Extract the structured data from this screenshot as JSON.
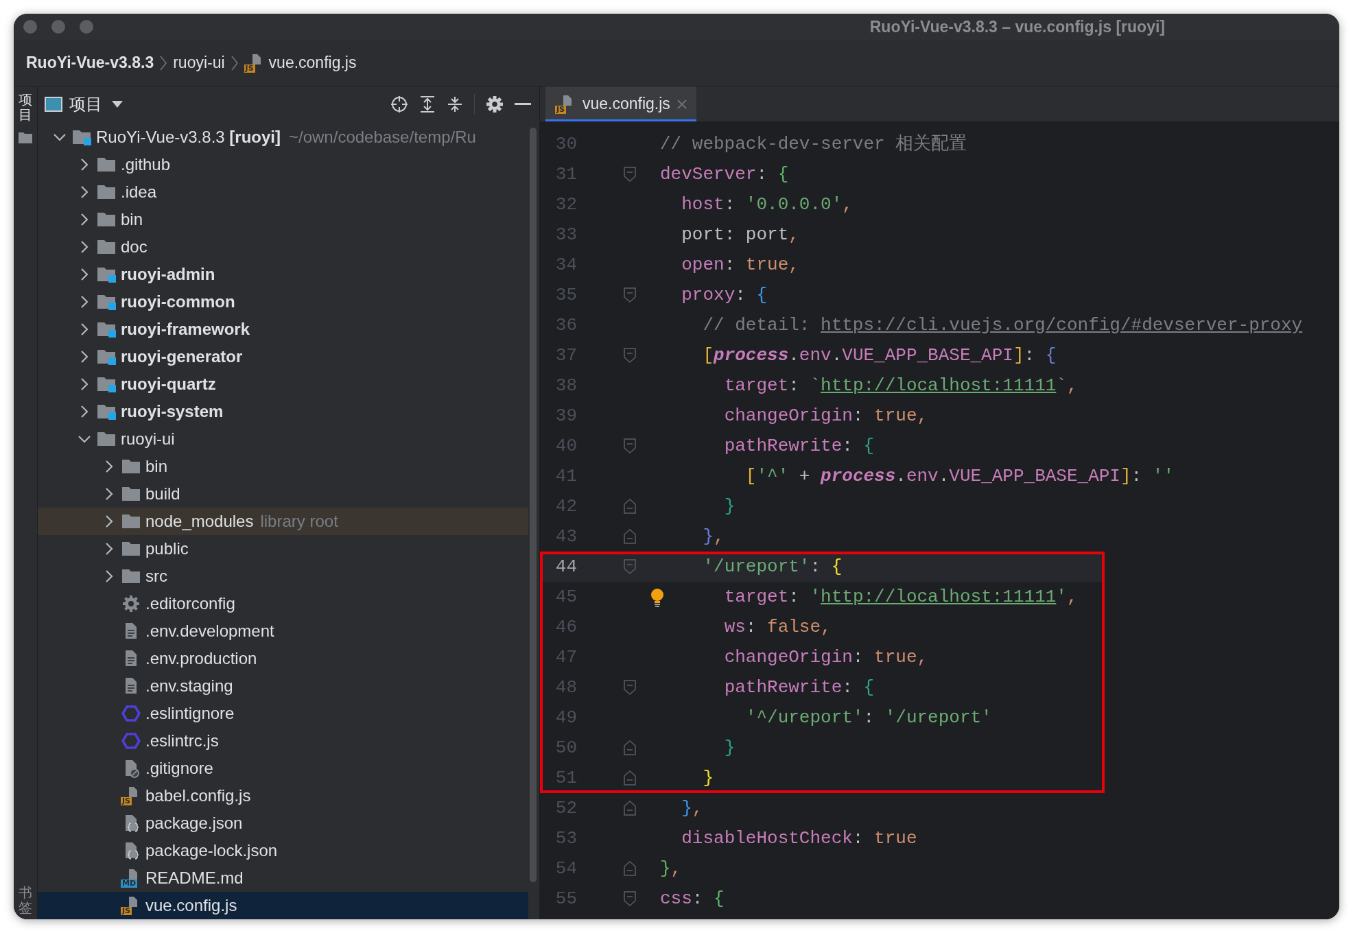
{
  "window": {
    "title": "RuoYi-Vue-v3.8.3 – vue.config.js [ruoyi]"
  },
  "breadcrumbs": [
    {
      "label": "RuoYi-Vue-v3.8.3",
      "bold": true
    },
    {
      "label": "ruoyi-ui",
      "bold": false
    },
    {
      "label": "vue.config.js",
      "bold": false,
      "badge": "JS"
    }
  ],
  "tool_strip": {
    "top_label": "项目",
    "bottom_label": "书签"
  },
  "project": {
    "title": "项目",
    "tree": [
      {
        "label": "RuoYi-Vue-v3.8.3 **[ruoyi]**",
        "path": "~/own/codebase/temp/Ru",
        "kind": "module",
        "bold": false,
        "expanded": true,
        "selected": false,
        "highlighted": false,
        "children": [
          {
            "label": ".github",
            "kind": "folder",
            "bold": false,
            "expanded": false,
            "selected": false,
            "highlighted": false
          },
          {
            "label": ".idea",
            "kind": "folder",
            "bold": false,
            "expanded": false,
            "selected": false,
            "highlighted": false
          },
          {
            "label": "bin",
            "kind": "folder",
            "bold": false,
            "expanded": false,
            "selected": false,
            "highlighted": false
          },
          {
            "label": "doc",
            "kind": "folder",
            "bold": false,
            "expanded": false,
            "selected": false,
            "highlighted": false
          },
          {
            "label": "ruoyi-admin",
            "kind": "module",
            "bold": true,
            "expanded": false,
            "selected": false,
            "highlighted": false
          },
          {
            "label": "ruoyi-common",
            "kind": "module",
            "bold": true,
            "expanded": false,
            "selected": false,
            "highlighted": false
          },
          {
            "label": "ruoyi-framework",
            "kind": "module",
            "bold": true,
            "expanded": false,
            "selected": false,
            "highlighted": false
          },
          {
            "label": "ruoyi-generator",
            "kind": "module",
            "bold": true,
            "expanded": false,
            "selected": false,
            "highlighted": false
          },
          {
            "label": "ruoyi-quartz",
            "kind": "module",
            "bold": true,
            "expanded": false,
            "selected": false,
            "highlighted": false
          },
          {
            "label": "ruoyi-system",
            "kind": "module",
            "bold": true,
            "expanded": false,
            "selected": false,
            "highlighted": false
          },
          {
            "label": "ruoyi-ui",
            "kind": "folder",
            "bold": false,
            "expanded": true,
            "selected": false,
            "highlighted": false,
            "children": [
              {
                "label": "bin",
                "kind": "folder",
                "bold": false,
                "expanded": false,
                "selected": false,
                "highlighted": false
              },
              {
                "label": "build",
                "kind": "folder",
                "bold": false,
                "expanded": false,
                "selected": false,
                "highlighted": false
              },
              {
                "label": "node_modules",
                "note": "library root",
                "kind": "folder",
                "bold": false,
                "expanded": false,
                "selected": false,
                "highlighted": true
              },
              {
                "label": "public",
                "kind": "folder",
                "bold": false,
                "expanded": false,
                "selected": false,
                "highlighted": false
              },
              {
                "label": "src",
                "kind": "folder",
                "bold": false,
                "expanded": false,
                "selected": false,
                "highlighted": false
              },
              {
                "label": ".editorconfig",
                "kind": "settings",
                "bold": false,
                "selected": false,
                "highlighted": false
              },
              {
                "label": ".env.development",
                "kind": "text",
                "bold": false,
                "selected": false,
                "highlighted": false
              },
              {
                "label": ".env.production",
                "kind": "text",
                "bold": false,
                "selected": false,
                "highlighted": false
              },
              {
                "label": ".env.staging",
                "kind": "text",
                "bold": false,
                "selected": false,
                "highlighted": false
              },
              {
                "label": ".eslintignore",
                "kind": "eslint",
                "bold": false,
                "selected": false,
                "highlighted": false
              },
              {
                "label": ".eslintrc.js",
                "kind": "eslint",
                "bold": false,
                "selected": false,
                "highlighted": false
              },
              {
                "label": ".gitignore",
                "kind": "gitignore",
                "bold": false,
                "selected": false,
                "highlighted": false
              },
              {
                "label": "babel.config.js",
                "kind": "badge",
                "badge": "JS",
                "color": "#c7861f",
                "bold": false,
                "selected": false,
                "highlighted": false
              },
              {
                "label": "package.json",
                "kind": "json",
                "bold": false,
                "selected": false,
                "highlighted": false
              },
              {
                "label": "package-lock.json",
                "kind": "json",
                "bold": false,
                "selected": false,
                "highlighted": false
              },
              {
                "label": "README.md",
                "kind": "badge",
                "badge": "MD",
                "color": "#2f8fc4",
                "bold": false,
                "selected": false,
                "highlighted": false
              },
              {
                "label": "vue.config.js",
                "kind": "badge",
                "badge": "JS",
                "color": "#c7861f",
                "bold": false,
                "selected": true,
                "highlighted": false
              }
            ]
          }
        ]
      }
    ]
  },
  "editor": {
    "tabs": [
      {
        "label": "vue.config.js",
        "badge": "JS",
        "selected": true
      }
    ],
    "lines": [
      {
        "number": "30",
        "fold_start": false,
        "fold_end": false,
        "current": false,
        "boxed": false,
        "hint": false,
        "tokens": [
          {
            "text": "// webpack-dev-server 相关配置",
            "kind": "comment"
          }
        ]
      },
      {
        "number": "31",
        "fold_start": true,
        "fold_end": false,
        "current": false,
        "boxed": false,
        "hint": false,
        "tokens": [
          {
            "text": "devServer",
            "kind": "key"
          },
          {
            "text": ": ",
            "kind": "plain"
          },
          {
            "text": "{",
            "kind": "bracket",
            "color": "#5fb865"
          }
        ]
      },
      {
        "number": "32",
        "fold_start": false,
        "fold_end": false,
        "current": false,
        "boxed": false,
        "hint": false,
        "tokens": [
          {
            "text": "  host",
            "kind": "key"
          },
          {
            "text": ": ",
            "kind": "plain"
          },
          {
            "text": "'0.0.0.0'",
            "kind": "string"
          },
          {
            "text": ",",
            "kind": "punct"
          }
        ]
      },
      {
        "number": "33",
        "fold_start": false,
        "fold_end": false,
        "current": false,
        "boxed": false,
        "hint": false,
        "tokens": [
          {
            "text": "  port: port",
            "kind": "plain"
          },
          {
            "text": ",",
            "kind": "punct"
          }
        ]
      },
      {
        "number": "34",
        "fold_start": false,
        "fold_end": false,
        "current": false,
        "boxed": false,
        "hint": false,
        "tokens": [
          {
            "text": "  open",
            "kind": "key"
          },
          {
            "text": ": ",
            "kind": "plain"
          },
          {
            "text": "true",
            "kind": "literal"
          },
          {
            "text": ",",
            "kind": "punct"
          }
        ]
      },
      {
        "number": "35",
        "fold_start": true,
        "fold_end": false,
        "current": false,
        "boxed": false,
        "hint": false,
        "tokens": [
          {
            "text": "  proxy",
            "kind": "key"
          },
          {
            "text": ": ",
            "kind": "plain"
          },
          {
            "text": "{",
            "kind": "bracket",
            "color": "#3d9ae8"
          }
        ]
      },
      {
        "number": "36",
        "fold_start": false,
        "fold_end": false,
        "current": false,
        "boxed": false,
        "hint": false,
        "tokens": [
          {
            "text": "    // detail: ",
            "kind": "comment"
          },
          {
            "text": "https://cli.vuejs.org/config/#devserver-proxy",
            "kind": "doclink"
          }
        ]
      },
      {
        "number": "37",
        "fold_start": true,
        "fold_end": false,
        "current": false,
        "boxed": false,
        "hint": false,
        "tokens": [
          {
            "text": "    [",
            "kind": "bracket",
            "color": "#e5b33a"
          },
          {
            "text": "process",
            "kind": "global"
          },
          {
            "text": ".",
            "kind": "plain"
          },
          {
            "text": "env",
            "kind": "key"
          },
          {
            "text": ".",
            "kind": "plain"
          },
          {
            "text": "VUE_APP_BASE_API",
            "kind": "key"
          },
          {
            "text": "]",
            "kind": "bracket",
            "color": "#e5b33a"
          },
          {
            "text": ": ",
            "kind": "plain"
          },
          {
            "text": "{",
            "kind": "bracket",
            "color": "#6c7fd6"
          }
        ]
      },
      {
        "number": "38",
        "fold_start": false,
        "fold_end": false,
        "current": false,
        "boxed": false,
        "hint": false,
        "tokens": [
          {
            "text": "      target",
            "kind": "key"
          },
          {
            "text": ": ",
            "kind": "plain"
          },
          {
            "text": "`",
            "kind": "string"
          },
          {
            "text": "http://localhost:11111",
            "kind": "link"
          },
          {
            "text": "`",
            "kind": "string"
          },
          {
            "text": ",",
            "kind": "punct"
          }
        ]
      },
      {
        "number": "39",
        "fold_start": false,
        "fold_end": false,
        "current": false,
        "boxed": false,
        "hint": false,
        "tokens": [
          {
            "text": "      changeOrigin",
            "kind": "key"
          },
          {
            "text": ": ",
            "kind": "plain"
          },
          {
            "text": "true",
            "kind": "literal"
          },
          {
            "text": ",",
            "kind": "punct"
          }
        ]
      },
      {
        "number": "40",
        "fold_start": true,
        "fold_end": false,
        "current": false,
        "boxed": false,
        "hint": false,
        "tokens": [
          {
            "text": "      pathRewrite",
            "kind": "key"
          },
          {
            "text": ": ",
            "kind": "plain"
          },
          {
            "text": "{",
            "kind": "bracket",
            "color": "#2aa58f"
          }
        ]
      },
      {
        "number": "41",
        "fold_start": false,
        "fold_end": false,
        "current": false,
        "boxed": false,
        "hint": false,
        "tokens": [
          {
            "text": "        [",
            "kind": "bracket",
            "color": "#e5b33a"
          },
          {
            "text": "'^'",
            "kind": "string"
          },
          {
            "text": " + ",
            "kind": "plain"
          },
          {
            "text": "process",
            "kind": "global"
          },
          {
            "text": ".",
            "kind": "plain"
          },
          {
            "text": "env",
            "kind": "key"
          },
          {
            "text": ".",
            "kind": "plain"
          },
          {
            "text": "VUE_APP_BASE_API",
            "kind": "key"
          },
          {
            "text": "]",
            "kind": "bracket",
            "color": "#e5b33a"
          },
          {
            "text": ": ",
            "kind": "plain"
          },
          {
            "text": "''",
            "kind": "string"
          }
        ]
      },
      {
        "number": "42",
        "fold_start": false,
        "fold_end": true,
        "current": false,
        "boxed": false,
        "hint": false,
        "tokens": [
          {
            "text": "      }",
            "kind": "bracket",
            "color": "#2aa58f"
          }
        ]
      },
      {
        "number": "43",
        "fold_start": false,
        "fold_end": true,
        "current": false,
        "boxed": false,
        "hint": false,
        "tokens": [
          {
            "text": "    }",
            "kind": "bracket",
            "color": "#6c7fd6"
          },
          {
            "text": ",",
            "kind": "punct"
          }
        ]
      },
      {
        "number": "44",
        "fold_start": true,
        "fold_end": false,
        "current": true,
        "boxed": true,
        "hint": false,
        "tokens": [
          {
            "text": "    '/ureport'",
            "kind": "string"
          },
          {
            "text": ": ",
            "kind": "plain"
          },
          {
            "text": "{",
            "kind": "bracket",
            "color": "#f5e52a"
          }
        ]
      },
      {
        "number": "45",
        "fold_start": false,
        "fold_end": false,
        "current": false,
        "boxed": true,
        "hint": true,
        "tokens": [
          {
            "text": "      target",
            "kind": "key"
          },
          {
            "text": ": ",
            "kind": "plain"
          },
          {
            "text": "'",
            "kind": "string"
          },
          {
            "text": "http://localhost:11111",
            "kind": "link"
          },
          {
            "text": "'",
            "kind": "string"
          },
          {
            "text": ",",
            "kind": "punct"
          }
        ]
      },
      {
        "number": "46",
        "fold_start": false,
        "fold_end": false,
        "current": false,
        "boxed": true,
        "hint": false,
        "tokens": [
          {
            "text": "      ws",
            "kind": "key"
          },
          {
            "text": ": ",
            "kind": "plain"
          },
          {
            "text": "false",
            "kind": "literal"
          },
          {
            "text": ",",
            "kind": "punct"
          }
        ]
      },
      {
        "number": "47",
        "fold_start": false,
        "fold_end": false,
        "current": false,
        "boxed": true,
        "hint": false,
        "tokens": [
          {
            "text": "      changeOrigin",
            "kind": "key"
          },
          {
            "text": ": ",
            "kind": "plain"
          },
          {
            "text": "true",
            "kind": "literal"
          },
          {
            "text": ",",
            "kind": "punct"
          }
        ]
      },
      {
        "number": "48",
        "fold_start": true,
        "fold_end": false,
        "current": false,
        "boxed": true,
        "hint": false,
        "tokens": [
          {
            "text": "      pathRewrite",
            "kind": "key"
          },
          {
            "text": ": ",
            "kind": "plain"
          },
          {
            "text": "{",
            "kind": "bracket",
            "color": "#2aa58f"
          }
        ]
      },
      {
        "number": "49",
        "fold_start": false,
        "fold_end": false,
        "current": false,
        "boxed": true,
        "hint": false,
        "tokens": [
          {
            "text": "        '^/ureport'",
            "kind": "string"
          },
          {
            "text": ": ",
            "kind": "plain"
          },
          {
            "text": "'/ureport'",
            "kind": "string"
          }
        ]
      },
      {
        "number": "50",
        "fold_start": false,
        "fold_end": true,
        "current": false,
        "boxed": true,
        "hint": false,
        "tokens": [
          {
            "text": "      }",
            "kind": "bracket",
            "color": "#2aa58f"
          }
        ]
      },
      {
        "number": "51",
        "fold_start": false,
        "fold_end": true,
        "current": false,
        "boxed": true,
        "hint": false,
        "tokens": [
          {
            "text": "    }",
            "kind": "bracket",
            "color": "#f5e52a"
          }
        ]
      },
      {
        "number": "52",
        "fold_start": false,
        "fold_end": true,
        "current": false,
        "boxed": false,
        "hint": false,
        "tokens": [
          {
            "text": "  }",
            "kind": "bracket",
            "color": "#3d9ae8"
          },
          {
            "text": ",",
            "kind": "punct"
          }
        ]
      },
      {
        "number": "53",
        "fold_start": false,
        "fold_end": false,
        "current": false,
        "boxed": false,
        "hint": false,
        "tokens": [
          {
            "text": "  disableHostCheck",
            "kind": "key"
          },
          {
            "text": ": ",
            "kind": "plain"
          },
          {
            "text": "true",
            "kind": "literal"
          }
        ]
      },
      {
        "number": "54",
        "fold_start": false,
        "fold_end": true,
        "current": false,
        "boxed": false,
        "hint": false,
        "tokens": [
          {
            "text": "}",
            "kind": "bracket",
            "color": "#5fb865"
          },
          {
            "text": ",",
            "kind": "punct"
          }
        ]
      },
      {
        "number": "55",
        "fold_start": true,
        "fold_end": false,
        "current": false,
        "boxed": false,
        "hint": false,
        "tokens": [
          {
            "text": "css",
            "kind": "key"
          },
          {
            "text": ": ",
            "kind": "plain"
          },
          {
            "text": "{",
            "kind": "bracket",
            "color": "#5fb865"
          }
        ]
      }
    ]
  }
}
